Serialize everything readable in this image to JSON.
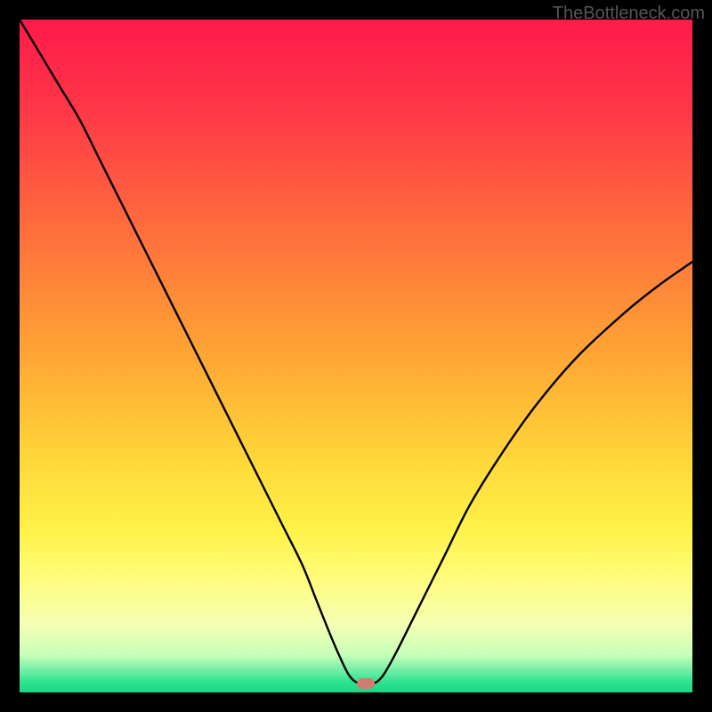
{
  "watermark": "TheBottleneck.com",
  "chart_data": {
    "type": "line",
    "title": "",
    "xlabel": "",
    "ylabel": "",
    "xlim": [
      0,
      100
    ],
    "ylim": [
      0,
      100
    ],
    "grid": false,
    "background": "heatmap-gradient",
    "gradient_stops": [
      {
        "pos": 0.0,
        "color": "#ff1a4a"
      },
      {
        "pos": 0.13,
        "color": "#ff3648"
      },
      {
        "pos": 0.3,
        "color": "#ff6a3d"
      },
      {
        "pos": 0.5,
        "color": "#ffa634"
      },
      {
        "pos": 0.66,
        "color": "#ffd93a"
      },
      {
        "pos": 0.76,
        "color": "#fff248"
      },
      {
        "pos": 0.83,
        "color": "#fffc7c"
      },
      {
        "pos": 0.9,
        "color": "#f4ffb4"
      },
      {
        "pos": 0.945,
        "color": "#c6ffb8"
      },
      {
        "pos": 0.965,
        "color": "#7af0a8"
      },
      {
        "pos": 0.985,
        "color": "#2ce28f"
      },
      {
        "pos": 1.0,
        "color": "#16d884"
      }
    ],
    "series": [
      {
        "name": "bottleneck-curve",
        "color": "#000000",
        "x": [
          0.0,
          3.0,
          6.0,
          9.0,
          12.0,
          15.0,
          18.0,
          21.0,
          24.0,
          27.0,
          30.0,
          33.0,
          36.0,
          39.0,
          42.0,
          44.0,
          46.0,
          47.5,
          49.0,
          50.5,
          52.5,
          54.0,
          56.0,
          59.0,
          63.0,
          67.0,
          72.0,
          77.0,
          83.0,
          90.0,
          95.0,
          100.0
        ],
        "y": [
          100.0,
          95.0,
          90.0,
          85.0,
          79.0,
          73.0,
          67.0,
          61.0,
          55.0,
          49.0,
          43.0,
          37.0,
          31.0,
          25.0,
          19.0,
          14.0,
          9.0,
          5.5,
          2.5,
          1.3,
          1.3,
          2.5,
          6.0,
          12.0,
          20.0,
          28.0,
          36.0,
          43.0,
          50.0,
          56.5,
          60.5,
          64.0
        ]
      }
    ],
    "marker": {
      "x": 51.5,
      "y": 1.3,
      "color": "#cf7b70"
    }
  }
}
